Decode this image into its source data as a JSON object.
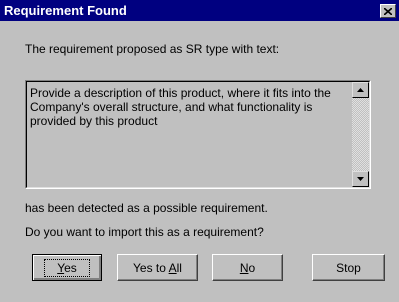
{
  "window": {
    "title": "Requirement Found",
    "close_symbol": "×"
  },
  "dialog": {
    "intro_text": "The requirement proposed as SR type with text:",
    "requirement_text": "Provide a description of this product, where it fits into the Company's overall structure, and what functionality is provided by this product",
    "detected_text": "has been detected as a possible requirement.",
    "question_text": "Do you want to import this as a requirement?"
  },
  "buttons": {
    "yes": {
      "prefix": "",
      "accel": "Y",
      "suffix": "es"
    },
    "yes_to_all": {
      "prefix": "Yes to ",
      "accel": "A",
      "suffix": "ll"
    },
    "no": {
      "prefix": "",
      "accel": "N",
      "suffix": "o"
    },
    "stop": {
      "label": "Stop"
    }
  },
  "icons": {
    "close": "close-icon",
    "scroll_up": "scroll-up-arrow-icon",
    "scroll_down": "scroll-down-arrow-icon"
  }
}
